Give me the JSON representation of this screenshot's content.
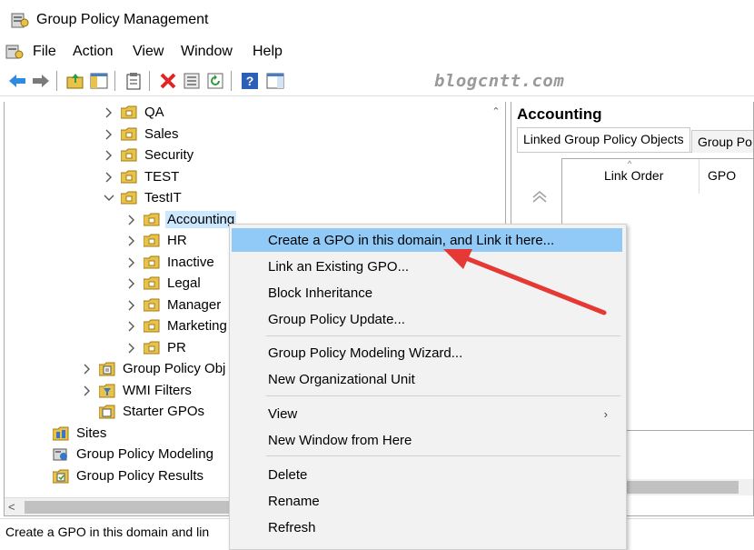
{
  "window": {
    "title": "Group Policy Management"
  },
  "menu": [
    "File",
    "Action",
    "View",
    "Window",
    "Help"
  ],
  "toolbar": {
    "buttons": [
      "back-icon",
      "forward-icon",
      "up-folder-icon",
      "show-tree-icon",
      "properties-icon",
      "delete-icon",
      "export-icon",
      "refresh-icon",
      "help-icon",
      "action-pane-icon"
    ],
    "watermark": "blogcntt.com"
  },
  "tree": {
    "items": [
      {
        "label": "QA",
        "icon": "ou-folder-icon",
        "expander": "collapsed"
      },
      {
        "label": "Sales",
        "icon": "ou-folder-icon",
        "expander": "collapsed"
      },
      {
        "label": "Security",
        "icon": "ou-folder-icon",
        "expander": "collapsed"
      },
      {
        "label": "TEST",
        "icon": "ou-folder-icon",
        "expander": "collapsed"
      },
      {
        "label": "TestIT",
        "icon": "ou-folder-icon",
        "expander": "expanded"
      },
      {
        "label": "Accounting",
        "icon": "ou-folder-icon",
        "expander": "collapsed",
        "selected": true
      },
      {
        "label": "HR",
        "icon": "ou-folder-icon",
        "expander": "collapsed"
      },
      {
        "label": "Inactive",
        "icon": "ou-folder-icon",
        "expander": "collapsed"
      },
      {
        "label": "Legal",
        "icon": "ou-folder-icon",
        "expander": "collapsed"
      },
      {
        "label": "Manager",
        "icon": "ou-folder-icon",
        "expander": "collapsed"
      },
      {
        "label": "Marketing",
        "icon": "ou-folder-icon",
        "expander": "collapsed"
      },
      {
        "label": "PR",
        "icon": "ou-folder-icon",
        "expander": "collapsed"
      },
      {
        "label": "Group Policy Obj",
        "icon": "gpo-folder-icon",
        "expander": "collapsed"
      },
      {
        "label": "WMI Filters",
        "icon": "wmi-folder-icon",
        "expander": "collapsed"
      },
      {
        "label": "Starter GPOs",
        "icon": "starter-gpo-icon",
        "expander": "none"
      },
      {
        "label": "Sites",
        "icon": "sites-icon",
        "expander": "none"
      },
      {
        "label": "Group Policy Modeling",
        "icon": "modeling-icon",
        "expander": "none"
      },
      {
        "label": "Group Policy Results",
        "icon": "results-icon",
        "expander": "none"
      }
    ]
  },
  "right_pane": {
    "title": "Accounting",
    "tabs": [
      "Linked Group Policy Objects",
      "Group Po"
    ],
    "columns": [
      "Link Order",
      "GPO"
    ]
  },
  "context_menu": {
    "items": [
      {
        "label": "Create a GPO in this domain, and Link it here...",
        "highlighted": true
      },
      {
        "label": "Link an Existing GPO..."
      },
      {
        "label": "Block Inheritance"
      },
      {
        "label": "Group Policy Update..."
      },
      {
        "label": "Group Policy Modeling Wizard..."
      },
      {
        "label": "New Organizational Unit"
      },
      {
        "label": "View",
        "submenu": true
      },
      {
        "label": "New Window from Here"
      },
      {
        "label": "Delete"
      },
      {
        "label": "Rename"
      },
      {
        "label": "Refresh"
      }
    ]
  },
  "status": {
    "text": "Create a GPO in this domain and lin"
  },
  "colors": {
    "highlight": "#91c9f7",
    "selection": "#cce8ff",
    "annotation_arrow": "#e53935",
    "folder": "#e8c24a"
  }
}
